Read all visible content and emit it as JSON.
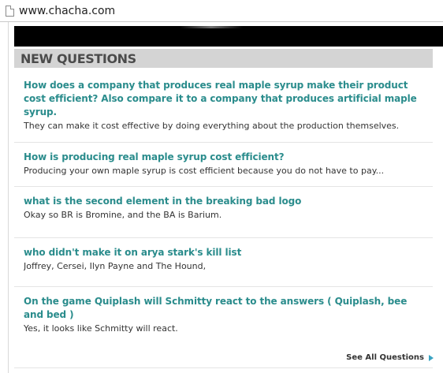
{
  "browser": {
    "url": "www.chacha.com",
    "page_icon": "page-icon"
  },
  "section": {
    "title": "NEW QUESTIONS"
  },
  "questions": [
    {
      "title": "How does a company that produces real maple syrup make their product cost efficient? Also compare it to a company that produces artificial maple syrup.",
      "answer": "They can make it cost effective by doing everything about the production themselves."
    },
    {
      "title": "How is producing real maple syrup cost efficient?",
      "answer": "Producing your own maple syrup is cost efficient because you do not have to pay..."
    },
    {
      "title": "what is the second element in the breaking bad logo",
      "answer": "Okay so BR is Bromine, and the BA is Barium."
    },
    {
      "title": "who didn't make it on arya stark's kill list",
      "answer": "Joffrey, Cersei, Ilyn Payne and The Hound,"
    },
    {
      "title": "On the game Quiplash will Schmitty react to the answers ( Quiplash, bee and bed )",
      "answer": "Yes, it looks like Schmitty will react."
    }
  ],
  "footer": {
    "see_all_label": "See All Questions",
    "arrow_icon": "arrow-right-icon"
  },
  "colors": {
    "link": "#2a8c8c",
    "header_bg": "#d4d4d4",
    "arrow": "#3aa3c2"
  }
}
